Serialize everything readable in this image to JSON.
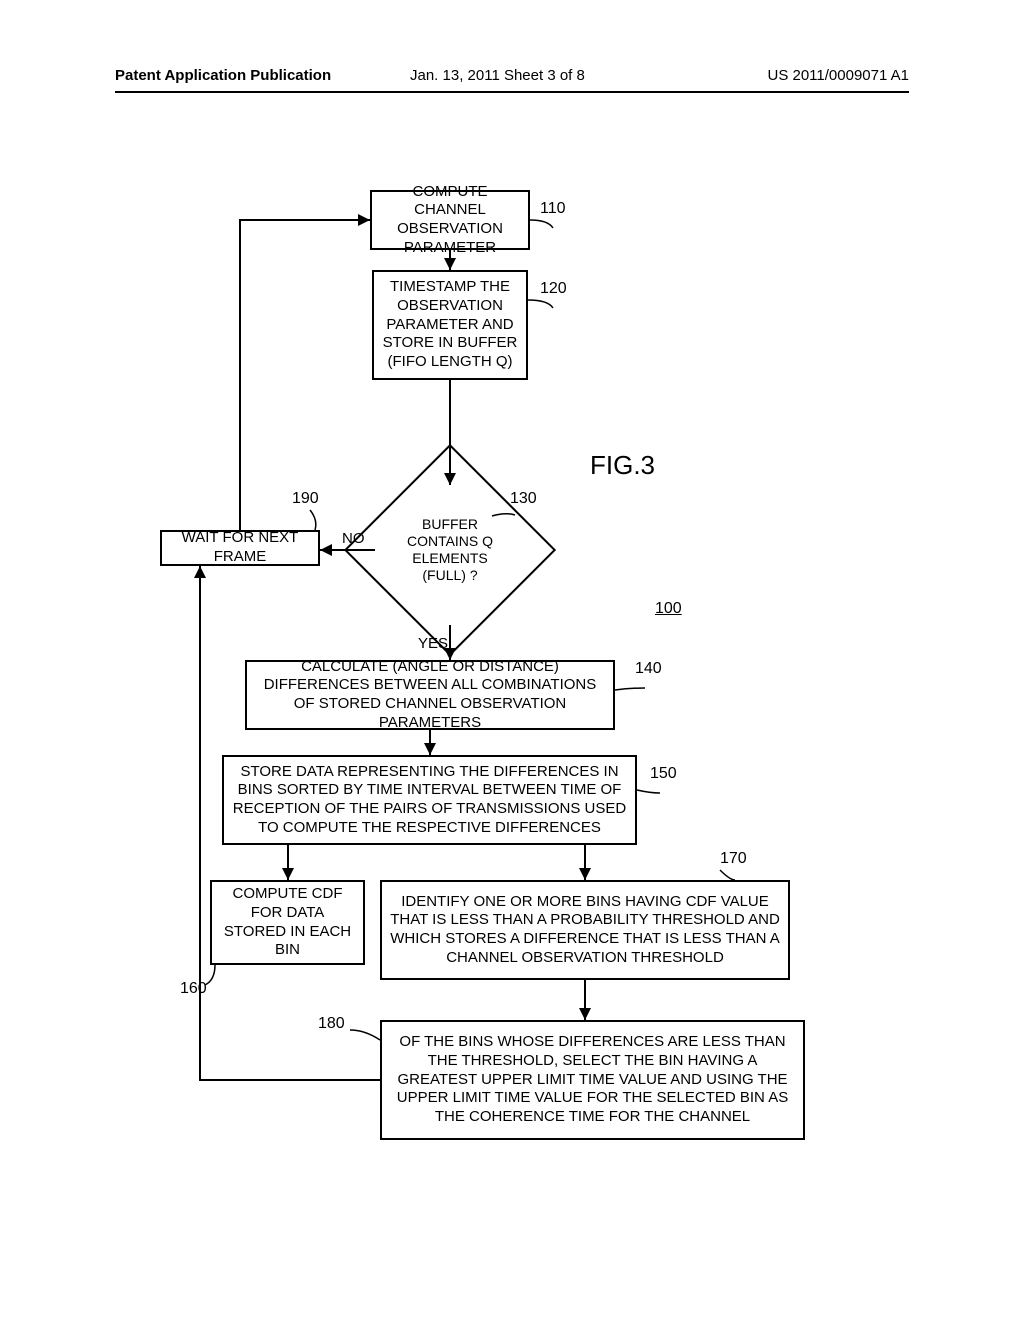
{
  "header": {
    "left": "Patent Application Publication",
    "mid": "Jan. 13, 2011  Sheet 3 of 8",
    "right": "US 2011/0009071 A1"
  },
  "figure_label": "FIG.3",
  "figure_ref": "100",
  "refs": {
    "r110": "110",
    "r120": "120",
    "r130": "130",
    "r140": "140",
    "r150": "150",
    "r160": "160",
    "r170": "170",
    "r180": "180",
    "r190": "190"
  },
  "labels": {
    "no": "NO",
    "yes": "YES"
  },
  "boxes": {
    "b110": "COMPUTE CHANNEL OBSERVATION PARAMETER",
    "b120": "TIMESTAMP THE OBSERVATION PARAMETER AND STORE IN BUFFER (FIFO LENGTH Q)",
    "d130": "BUFFER CONTAINS Q ELEMENTS (FULL) ?",
    "b140": "CALCULATE (ANGLE OR DISTANCE) DIFFERENCES BETWEEN ALL COMBINATIONS OF STORED CHANNEL OBSERVATION PARAMETERS",
    "b150": "STORE DATA REPRESENTING THE DIFFERENCES IN BINS SORTED BY TIME INTERVAL BETWEEN TIME OF RECEPTION OF THE PAIRS OF TRANSMISSIONS USED TO COMPUTE THE RESPECTIVE DIFFERENCES",
    "b160": "COMPUTE CDF FOR DATA STORED IN EACH BIN",
    "b170": "IDENTIFY ONE OR MORE BINS HAVING CDF VALUE THAT IS LESS THAN A PROBABILITY THRESHOLD AND WHICH STORES A DIFFERENCE THAT IS LESS THAN A CHANNEL OBSERVATION THRESHOLD",
    "b180": "OF THE BINS WHOSE DIFFERENCES ARE LESS THAN THE THRESHOLD, SELECT THE BIN HAVING A GREATEST UPPER LIMIT TIME VALUE AND USING THE UPPER LIMIT TIME VALUE FOR THE SELECTED BIN AS THE COHERENCE TIME FOR THE CHANNEL",
    "b190": "WAIT FOR NEXT FRAME"
  }
}
